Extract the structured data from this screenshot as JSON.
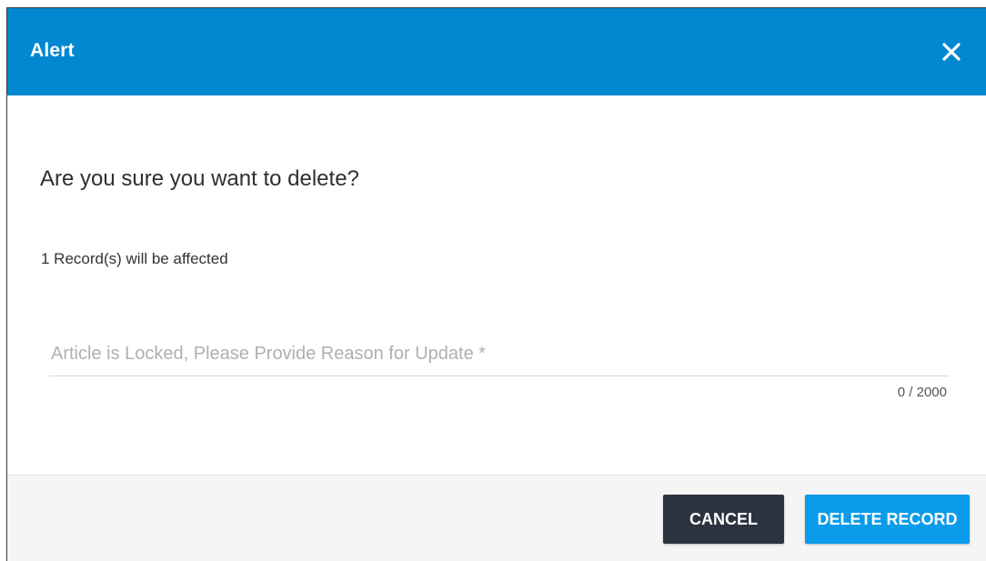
{
  "dialog": {
    "title": "Alert",
    "close_icon": "close-icon",
    "question": "Are you sure you want to delete?",
    "affected_text": "1 Record(s) will be affected",
    "reason": {
      "value": "",
      "placeholder": "Article is Locked, Please Provide Reason for Update *",
      "counter": "0 / 2000"
    },
    "buttons": {
      "cancel_label": "CANCEL",
      "delete_label": "DELETE RECORD"
    }
  },
  "colors": {
    "header": "#0288d1",
    "cancel_button": "#2b3340",
    "delete_button": "#0a9bea",
    "footer": "#f5f5f5"
  }
}
